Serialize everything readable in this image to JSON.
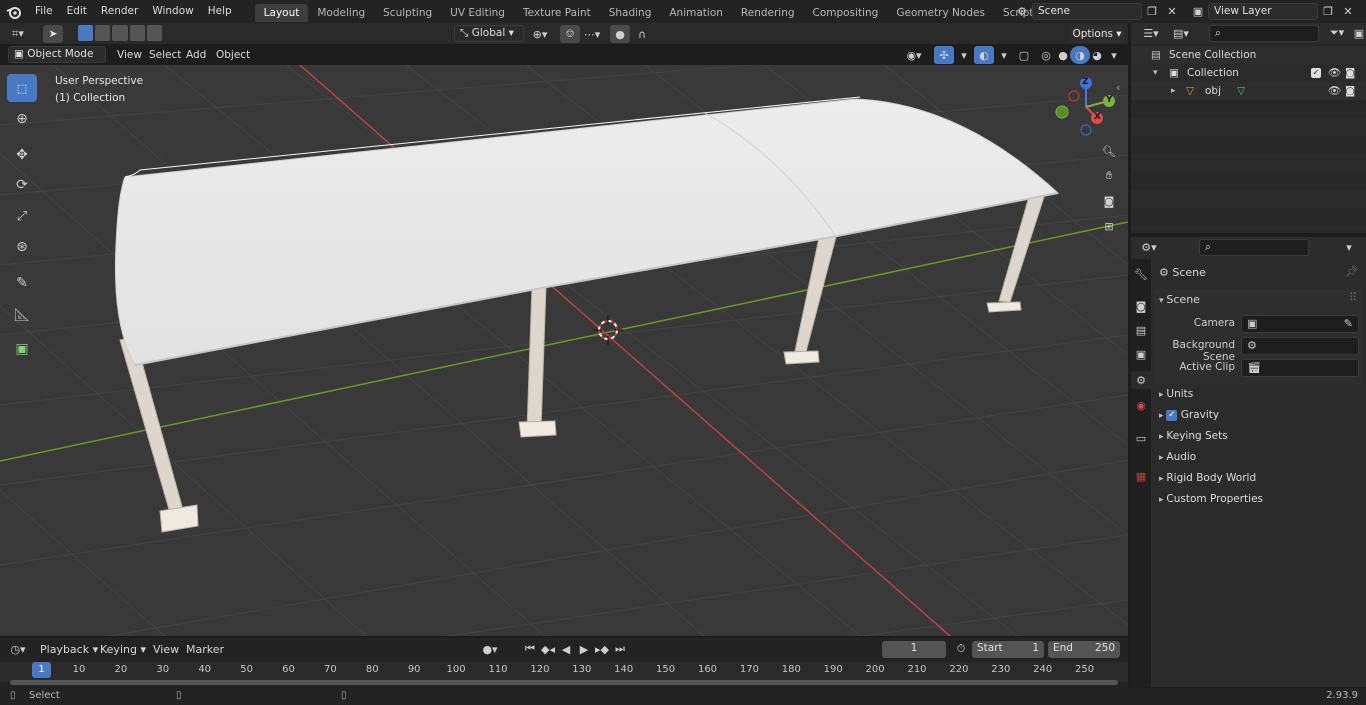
{
  "topbar": {
    "menus": [
      "File",
      "Edit",
      "Render",
      "Window",
      "Help"
    ],
    "workspaces": [
      "Layout",
      "Modeling",
      "Sculpting",
      "UV Editing",
      "Texture Paint",
      "Shading",
      "Animation",
      "Rendering",
      "Compositing",
      "Geometry Nodes",
      "Scripting"
    ],
    "active_workspace": "Layout",
    "scene_name": "Scene",
    "view_layer_name": "View Layer"
  },
  "viewport_header": {
    "mode": "Object Mode",
    "menus": [
      "View",
      "Select",
      "Add",
      "Object"
    ],
    "transform_orientation": "Global",
    "options_label": "Options"
  },
  "viewport": {
    "perspective_label": "User Perspective",
    "collection_label": "(1) Collection",
    "gizmo_axes": {
      "x": "X",
      "y": "Y",
      "z": "Z"
    }
  },
  "outliner": {
    "scene_collection": "Scene Collection",
    "collection": "Collection",
    "object": "obj"
  },
  "properties": {
    "context_title": "Scene",
    "panel_title": "Scene",
    "camera_label": "Camera",
    "background_scene_label": "Background Scene",
    "active_clip_label": "Active Clip",
    "subpanels": [
      "Units",
      "Gravity",
      "Keying Sets",
      "Audio",
      "Rigid Body World",
      "Custom Properties"
    ],
    "gravity_checked": true
  },
  "timeline": {
    "menus": [
      "Playback",
      "Keying",
      "View",
      "Marker"
    ],
    "current_frame": "1",
    "start_label": "Start",
    "start_value": "1",
    "end_label": "End",
    "end_value": "250",
    "ruler": [
      "1",
      "10",
      "20",
      "30",
      "40",
      "50",
      "60",
      "70",
      "80",
      "90",
      "100",
      "110",
      "120",
      "130",
      "140",
      "150",
      "160",
      "170",
      "180",
      "190",
      "200",
      "210",
      "220",
      "230",
      "240",
      "250"
    ]
  },
  "statusbar": {
    "left_label": "Select",
    "version": "2.93.9"
  },
  "colors": {
    "accent": "#4a79c4",
    "viewport_bg": "#393939",
    "x_axis": "#c04040",
    "y_axis": "#6a9a24",
    "canopy": "#e4e4e4"
  }
}
